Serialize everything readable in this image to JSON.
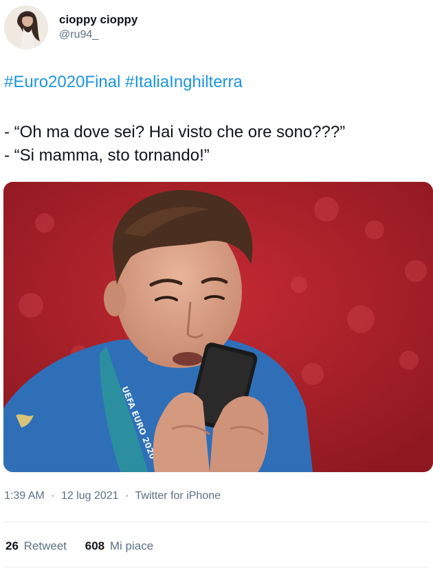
{
  "user": {
    "display_name": "cioppy cioppy",
    "handle": "@ru94_"
  },
  "tweet": {
    "hashtags": [
      "#Euro2020Final",
      "#ItaliaInghilterra"
    ],
    "lines": [
      "- “Oh ma dove sei? Hai visto che ore sono???”",
      "- “Si mamma, sto tornando!”"
    ],
    "media": {
      "lanyard_text": "UEFA EURO 2020",
      "colors": {
        "background": "#b3202a",
        "jersey": "#2f6fb8",
        "phone": "#1a1a1a"
      }
    }
  },
  "meta": {
    "time": "1:39 AM",
    "date": "12 lug 2021",
    "source": "Twitter for iPhone"
  },
  "stats": {
    "retweets_count": "26",
    "retweets_label": "Retweet",
    "likes_count": "608",
    "likes_label": "Mi piace"
  }
}
